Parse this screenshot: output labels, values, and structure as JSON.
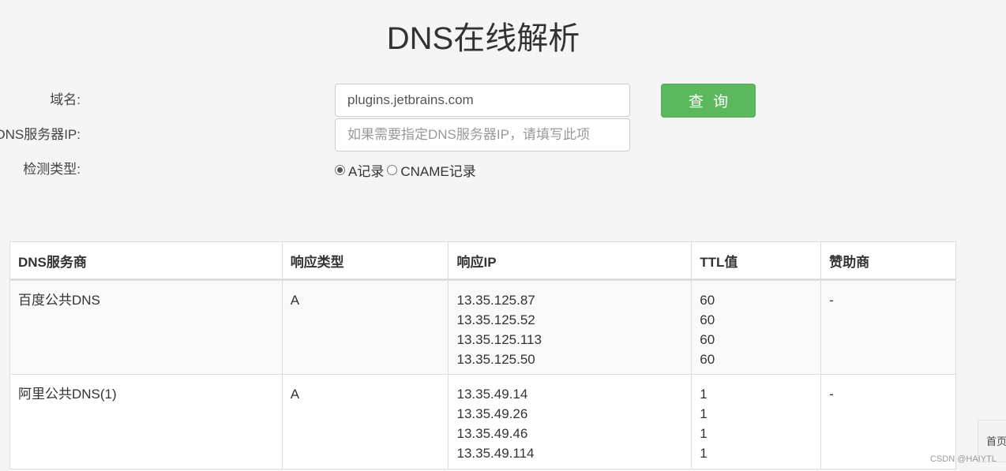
{
  "page": {
    "title": "DNS在线解析"
  },
  "form": {
    "domain_label": "域名:",
    "domain_value": "plugins.jetbrains.com",
    "dns_label": "DNS服务器IP:",
    "dns_placeholder": "如果需要指定DNS服务器IP，请填写此项",
    "dns_value": "",
    "type_label": "检测类型:",
    "type_options": [
      {
        "label": "A记录",
        "checked": true
      },
      {
        "label": "CNAME记录",
        "checked": false
      }
    ],
    "query_button": "查询"
  },
  "table": {
    "headers": [
      "DNS服务商",
      "响应类型",
      "响应IP",
      "TTL值",
      "赞助商"
    ],
    "rows": [
      {
        "provider": "百度公共DNS",
        "type": "A",
        "ips": [
          "13.35.125.87",
          "13.35.125.52",
          "13.35.125.113",
          "13.35.125.50"
        ],
        "ttls": [
          "60",
          "60",
          "60",
          "60"
        ],
        "sponsor": "-"
      },
      {
        "provider": "阿里公共DNS(1)",
        "type": "A",
        "ips": [
          "13.35.49.14",
          "13.35.49.26",
          "13.35.49.46",
          "13.35.49.114"
        ],
        "ttls": [
          "1",
          "1",
          "1",
          "1"
        ],
        "sponsor": "-"
      }
    ]
  },
  "side_tab": {
    "label": "首页"
  },
  "watermark": {
    "text": "CSDN @HAIYTL"
  }
}
